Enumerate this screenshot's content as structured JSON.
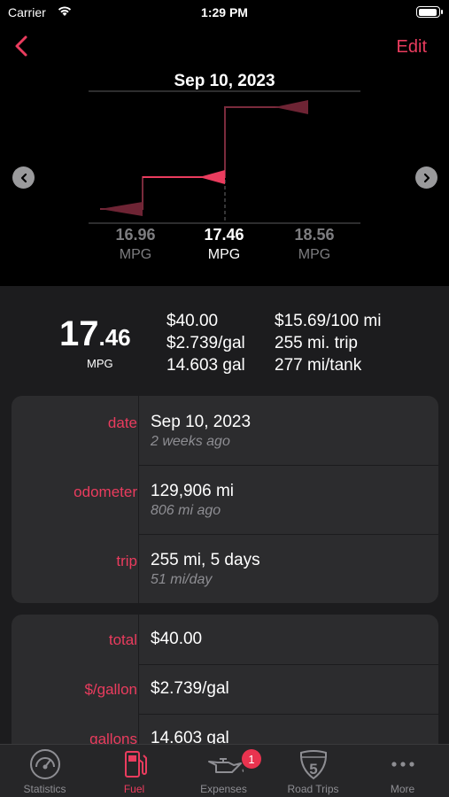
{
  "status_bar": {
    "carrier": "Carrier",
    "time": "1:29 PM"
  },
  "nav": {
    "edit_label": "Edit"
  },
  "chart": {
    "date": "Sep 10, 2023",
    "entries": [
      {
        "value": "16.96",
        "unit": "MPG"
      },
      {
        "value": "17.46",
        "unit": "MPG"
      },
      {
        "value": "18.56",
        "unit": "MPG"
      }
    ]
  },
  "summary": {
    "mpg_int": "17",
    "mpg_dec": ".46",
    "mpg_unit": "MPG",
    "col1": [
      "$40.00",
      "$2.739/gal",
      "14.603 gal"
    ],
    "col2": [
      "$15.69/100 mi",
      "255 mi. trip",
      "277 mi/tank"
    ]
  },
  "details": [
    {
      "label": "date",
      "value": "Sep 10, 2023",
      "sub": "2 weeks ago"
    },
    {
      "label": "odometer",
      "value": "129,906 mi",
      "sub": "806 mi ago"
    },
    {
      "label": "trip",
      "value": "255 mi, 5 days",
      "sub": "51 mi/day"
    }
  ],
  "costs": [
    {
      "label": "total",
      "value": "$40.00"
    },
    {
      "label": "$/gallon",
      "value": "$2.739/gal"
    },
    {
      "label": "gallons",
      "value": "14.603 gal"
    }
  ],
  "tabs": [
    {
      "label": "Statistics",
      "icon": "speedometer-icon"
    },
    {
      "label": "Fuel",
      "icon": "fuel-pump-icon"
    },
    {
      "label": "Expenses",
      "icon": "oil-can-icon",
      "badge": "1"
    },
    {
      "label": "Road Trips",
      "icon": "interstate-shield-icon"
    },
    {
      "label": "More",
      "icon": "more-icon"
    }
  ],
  "colors": {
    "accent": "#ea3c5e",
    "background": "#000000",
    "card": "#2c2c2e",
    "panel": "#1c1c1e"
  }
}
